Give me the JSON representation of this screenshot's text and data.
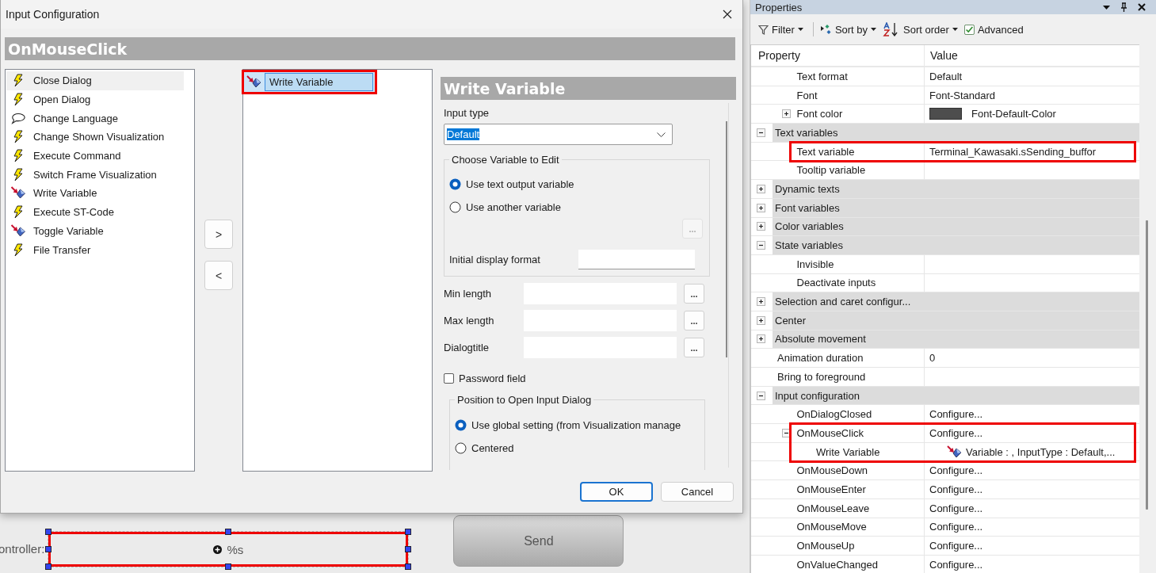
{
  "dialog": {
    "title": "Input Configuration",
    "event": "OnMouseClick",
    "actions": [
      {
        "label": "Close Dialog",
        "kind": "bolt",
        "selected": true
      },
      {
        "label": "Open Dialog",
        "kind": "bolt",
        "selected": false
      },
      {
        "label": "Change Language",
        "kind": "speech",
        "selected": false
      },
      {
        "label": "Change Shown Visualization",
        "kind": "bolt",
        "selected": false
      },
      {
        "label": "Execute Command",
        "kind": "bolt",
        "selected": false
      },
      {
        "label": "Switch Frame Visualization",
        "kind": "bolt",
        "selected": false
      },
      {
        "label": "Write Variable",
        "kind": "write",
        "selected": false
      },
      {
        "label": "Execute ST-Code",
        "kind": "bolt",
        "selected": false
      },
      {
        "label": "Toggle Variable",
        "kind": "write",
        "selected": false
      },
      {
        "label": "File Transfer",
        "kind": "bolt",
        "selected": false
      }
    ],
    "move_buttons": [
      ">",
      "<"
    ],
    "assigned": [
      {
        "label": "Write Variable",
        "kind": "write",
        "selected": true,
        "highlighted": true
      }
    ],
    "panel": {
      "title": "Write Variable",
      "input_type_label": "Input type",
      "input_type": "Default",
      "variable_group": {
        "legend": "Choose Variable to Edit",
        "options": [
          {
            "label": "Use text output variable",
            "selected": true
          },
          {
            "label": "Use another variable",
            "selected": false
          }
        ],
        "browse_button": {
          "label": "...",
          "disabled": true
        },
        "format_label": "Initial display format"
      },
      "fields": [
        {
          "label": "Min length",
          "button": "..."
        },
        {
          "label": "Max length",
          "button": "..."
        },
        {
          "label": "Dialogtitle",
          "button": "..."
        }
      ],
      "password": {
        "label": "Password field",
        "checked": false
      },
      "position_group": {
        "legend": "Position to Open Input Dialog",
        "options": [
          {
            "label": "Use global setting (from Visualization manage",
            "selected": true
          },
          {
            "label": "Centered",
            "selected": false
          }
        ]
      }
    },
    "buttons": [
      {
        "label": "OK",
        "default": true
      },
      {
        "label": "Cancel",
        "default": false
      }
    ]
  },
  "canvas": {
    "label": "ontroller:",
    "textbox": {
      "value": "%s",
      "highlighted": true
    },
    "send_button": "Send"
  },
  "properties": {
    "title": "Properties",
    "toolbar": [
      {
        "label": "Filter",
        "kind": "filter"
      },
      {
        "label": "Sort by",
        "kind": "sortby"
      },
      {
        "label": "Sort order",
        "kind": "sortorder"
      },
      {
        "label": "Advanced",
        "kind": "checkbox",
        "checked": true
      }
    ],
    "columns": [
      "Property",
      "Value"
    ],
    "rows": [
      {
        "kind": "continued",
        "children": [
          {
            "kind": "property",
            "label": "Text format",
            "value": "Default"
          },
          {
            "kind": "property",
            "label": "Font",
            "value": "Font-Standard"
          },
          {
            "kind": "property",
            "label": "Font color",
            "value": "Font-Default-Color",
            "color": "#4d4d4d",
            "expanded": false
          }
        ]
      },
      {
        "kind": "category",
        "label": "Text variables",
        "expanded": true,
        "children": [
          {
            "kind": "property",
            "label": "Text variable",
            "value": "Terminal_Kawasaki.sSending_buffor",
            "highlighted": true
          },
          {
            "kind": "property",
            "label": "Tooltip variable"
          }
        ]
      },
      {
        "kind": "category",
        "label": "Dynamic texts",
        "expanded": false
      },
      {
        "kind": "category",
        "label": "Font variables",
        "expanded": false
      },
      {
        "kind": "category",
        "label": "Color variables",
        "expanded": false
      },
      {
        "kind": "category",
        "label": "State variables",
        "expanded": true,
        "children": [
          {
            "kind": "property",
            "label": "Invisible"
          },
          {
            "kind": "property",
            "label": "Deactivate inputs"
          }
        ]
      },
      {
        "kind": "category",
        "label": "Selection and caret configur...",
        "expanded": false
      },
      {
        "kind": "category",
        "label": "Center",
        "expanded": false
      },
      {
        "kind": "category",
        "label": "Absolute movement",
        "expanded": false
      },
      {
        "kind": "property",
        "label": "Animation duration",
        "value": "0"
      },
      {
        "kind": "property",
        "label": "Bring to foreground"
      },
      {
        "kind": "category",
        "label": "Input configuration",
        "expanded": true,
        "children": [
          {
            "kind": "property",
            "label": "OnDialogClosed",
            "value": "Configure..."
          },
          {
            "kind": "property",
            "label": "OnMouseClick",
            "value": "Configure...",
            "expanded": true,
            "highlighted": true,
            "children": [
              {
                "kind": "action",
                "label": "Write Variable",
                "value": "Variable : , InputType : Default,..."
              }
            ]
          },
          {
            "kind": "property",
            "label": "OnMouseDown",
            "value": "Configure..."
          },
          {
            "kind": "property",
            "label": "OnMouseEnter",
            "value": "Configure..."
          },
          {
            "kind": "property",
            "label": "OnMouseLeave",
            "value": "Configure..."
          },
          {
            "kind": "property",
            "label": "OnMouseMove",
            "value": "Configure..."
          },
          {
            "kind": "property",
            "label": "OnMouseUp",
            "value": "Configure..."
          },
          {
            "kind": "property",
            "label": "OnValueChanged",
            "value": "Configure..."
          }
        ]
      }
    ]
  }
}
